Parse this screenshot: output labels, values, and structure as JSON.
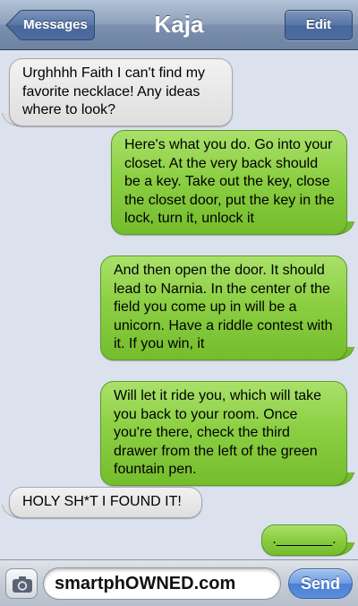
{
  "header": {
    "title": "Kaja",
    "back_label": "Messages",
    "edit_label": "Edit"
  },
  "messages": [
    {
      "direction": "incoming",
      "text": "Urghhhh Faith I can't find my favorite necklace! Any ideas where to look?"
    },
    {
      "direction": "outgoing",
      "text": "Here's what you do. Go into your closet. At the very back should be a key. Take out the key, close the closet door, put the key in the lock, turn it, unlock it"
    },
    {
      "direction": "outgoing",
      "text": "And then open the door. It should lead to Narnia. In the center of the field you come up in will be a unicorn. Have a riddle contest with it. If you win, it"
    },
    {
      "direction": "outgoing",
      "text": "Will let it ride you, which will take you back to your room. Once you're there, check the third drawer from the left of the green fountain pen."
    },
    {
      "direction": "incoming",
      "text": "HOLY SH*T I FOUND IT!"
    },
    {
      "direction": "outgoing",
      "text": "._______."
    }
  ],
  "input_bar": {
    "text_value": "smartphOWNED.com",
    "send_label": "Send",
    "camera_icon": "camera-icon"
  },
  "colors": {
    "outgoing_bubble": "#8ccf43",
    "incoming_bubble": "#e8e8e8",
    "background": "#dbe2ed",
    "navbar": "#8ea1bb",
    "send_button": "#5b8ee0"
  }
}
